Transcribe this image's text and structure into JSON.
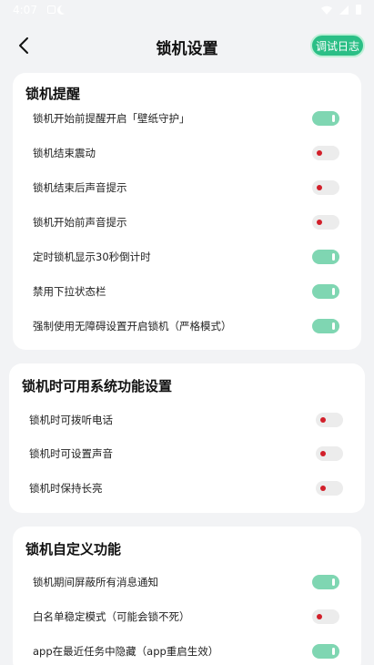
{
  "status_bar": {
    "time": "4:07"
  },
  "header": {
    "title": "锁机设置",
    "log_button": "调试日志"
  },
  "sections": [
    {
      "title": "锁机提醒",
      "items": [
        {
          "label": "锁机开始前提醒开启「壁纸守护」",
          "on": true
        },
        {
          "label": "锁机结束震动",
          "on": false
        },
        {
          "label": "锁机结束后声音提示",
          "on": false
        },
        {
          "label": "锁机开始前声音提示",
          "on": false
        },
        {
          "label": "定时锁机显示30秒倒计时",
          "on": true
        },
        {
          "label": "禁用下拉状态栏",
          "on": true
        },
        {
          "label": "强制使用无障碍设置开启锁机（严格模式）",
          "on": true
        }
      ]
    },
    {
      "title": "锁机时可用系统功能设置",
      "items": [
        {
          "label": "锁机时可拨听电话",
          "on": false
        },
        {
          "label": "锁机时可设置声音",
          "on": false
        },
        {
          "label": "锁机时保持长亮",
          "on": false
        }
      ]
    },
    {
      "title": "锁机自定义功能",
      "items": [
        {
          "label": "锁机期间屏蔽所有消息通知",
          "on": true
        },
        {
          "label": "白名单稳定模式（可能会锁不死）",
          "on": false
        },
        {
          "label": "app在最近任务中隐藏（app重启生效）",
          "on": true
        }
      ]
    }
  ]
}
